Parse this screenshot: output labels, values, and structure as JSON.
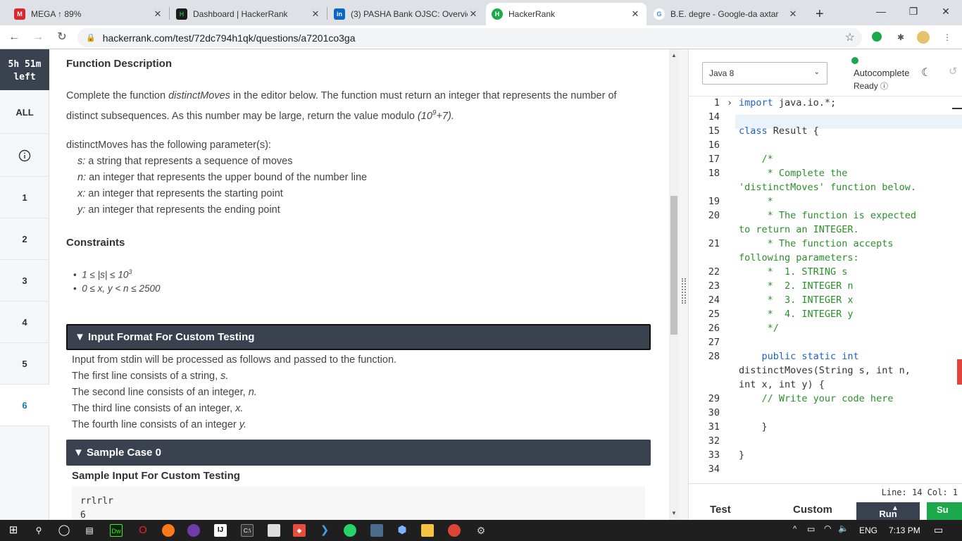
{
  "browser": {
    "tabs": [
      {
        "title": "MEGA ↑ 89%",
        "icon": "mega-icon",
        "color": "#d9272e",
        "glyph": "M"
      },
      {
        "title": "Dashboard | HackerRank",
        "icon": "hackerrank-icon",
        "color": "#1b1b1b",
        "glyph": "H"
      },
      {
        "title": "(3) PASHA Bank OJSC: Overvie",
        "icon": "linkedin-icon",
        "color": "#0a66c2",
        "glyph": "in"
      },
      {
        "title": "HackerRank",
        "icon": "hackerrank-icon",
        "color": "#1ba94c",
        "glyph": "H"
      },
      {
        "title": "B.E. degre - Google-da axtar",
        "icon": "google-icon",
        "color": "#ffffff",
        "glyph": "G"
      }
    ],
    "new_tab_label": "+",
    "url": "hackerrank.com/test/72dc794h1qk/questions/a7201co3ga"
  },
  "rail": {
    "timer": "5h 51m left",
    "timer_line1": "5h 51m",
    "timer_line2": "left",
    "all_label": "ALL",
    "questions": [
      "1",
      "2",
      "3",
      "4",
      "5",
      "6"
    ]
  },
  "problem": {
    "function_description_heading": "Function Description",
    "desc_line1_a": "Complete the function ",
    "desc_fn": "distinctMoves",
    "desc_line1_b": " in the editor below. The function must return an integer that represents the number of",
    "desc_line2": "distinct subsequences. As this number may be large, return the value modulo ",
    "desc_modulo": "(10",
    "desc_modulo_sup": "9",
    "desc_modulo_end": "+7).",
    "params_intro": "distinctMoves has the following parameter(s):",
    "params": [
      {
        "name": "s:",
        "desc": " a string that represents a sequence of moves"
      },
      {
        "name": "n:",
        "desc": " an integer that represents the upper bound of the number line"
      },
      {
        "name": "x:",
        "desc": " an integer that represents the starting point"
      },
      {
        "name": "y:",
        "desc": " an integer that represents the ending point"
      }
    ],
    "constraints_heading": "Constraints",
    "constraints": [
      {
        "text": "1 ≤ |s| ≤ 10",
        "sup": "3"
      },
      {
        "text": "0 ≤ x, y < n ≤ 2500",
        "sup": ""
      }
    ],
    "input_format_heading": "▼ Input Format For Custom Testing",
    "input_format_lines": [
      {
        "text": "Input from stdin will be processed as follows and passed to the function.",
        "var": ""
      },
      {
        "text": "The first line consists of a string, ",
        "var": "s."
      },
      {
        "text": "The second line consists of an integer, ",
        "var": "n."
      },
      {
        "text": "The third line consists of an integer, ",
        "var": "x."
      },
      {
        "text": "The fourth line consists of an integer ",
        "var": "y."
      }
    ],
    "sample_case_heading": "▼ Sample Case 0",
    "sample_input_heading": "Sample Input For Custom Testing",
    "sample_input": [
      "rrlrlr",
      "6"
    ]
  },
  "editor": {
    "language": "Java 8",
    "autocomplete_label": "Autocomplete",
    "ready_label": "Ready",
    "lines": [
      {
        "n": "1",
        "t": "import java.io.*;",
        "c": "kw-first",
        "fold": "›"
      },
      {
        "n": "14",
        "t": "",
        "c": ""
      },
      {
        "n": "15",
        "t": "class Result {",
        "c": "kw-first"
      },
      {
        "n": "16",
        "t": "",
        "c": ""
      },
      {
        "n": "17",
        "t": "    /*",
        "c": "cm"
      },
      {
        "n": "18",
        "t": "     * Complete the",
        "c": "cm"
      },
      {
        "n": "",
        "t": "'distinctMoves' function below.",
        "c": "cm"
      },
      {
        "n": "19",
        "t": "     *",
        "c": "cm"
      },
      {
        "n": "20",
        "t": "     * The function is expected",
        "c": "cm"
      },
      {
        "n": "",
        "t": "to return an INTEGER.",
        "c": "cm"
      },
      {
        "n": "21",
        "t": "     * The function accepts",
        "c": "cm"
      },
      {
        "n": "",
        "t": "following parameters:",
        "c": "cm"
      },
      {
        "n": "22",
        "t": "     *  1. STRING s",
        "c": "cm"
      },
      {
        "n": "23",
        "t": "     *  2. INTEGER n",
        "c": "cm"
      },
      {
        "n": "24",
        "t": "     *  3. INTEGER x",
        "c": "cm"
      },
      {
        "n": "25",
        "t": "     *  4. INTEGER y",
        "c": "cm"
      },
      {
        "n": "26",
        "t": "     */",
        "c": "cm"
      },
      {
        "n": "27",
        "t": "",
        "c": ""
      },
      {
        "n": "28",
        "t": "    public static int",
        "c": "kw"
      },
      {
        "n": "",
        "t": "distinctMoves(String s, int n,",
        "c": ""
      },
      {
        "n": "",
        "t": "int x, int y) {",
        "c": ""
      },
      {
        "n": "29",
        "t": "    // Write your code here",
        "c": "cm"
      },
      {
        "n": "30",
        "t": "",
        "c": ""
      },
      {
        "n": "31",
        "t": "    }",
        "c": ""
      },
      {
        "n": "32",
        "t": "",
        "c": ""
      },
      {
        "n": "33",
        "t": "}",
        "c": ""
      },
      {
        "n": "34",
        "t": "",
        "c": ""
      }
    ],
    "status": "Line: 14 Col: 1",
    "test_label": "Test",
    "custom_label": "Custom",
    "run_label": "Run",
    "submit_label": "Su"
  },
  "taskbar": {
    "lang": "ENG",
    "time": "7:13 PM"
  }
}
